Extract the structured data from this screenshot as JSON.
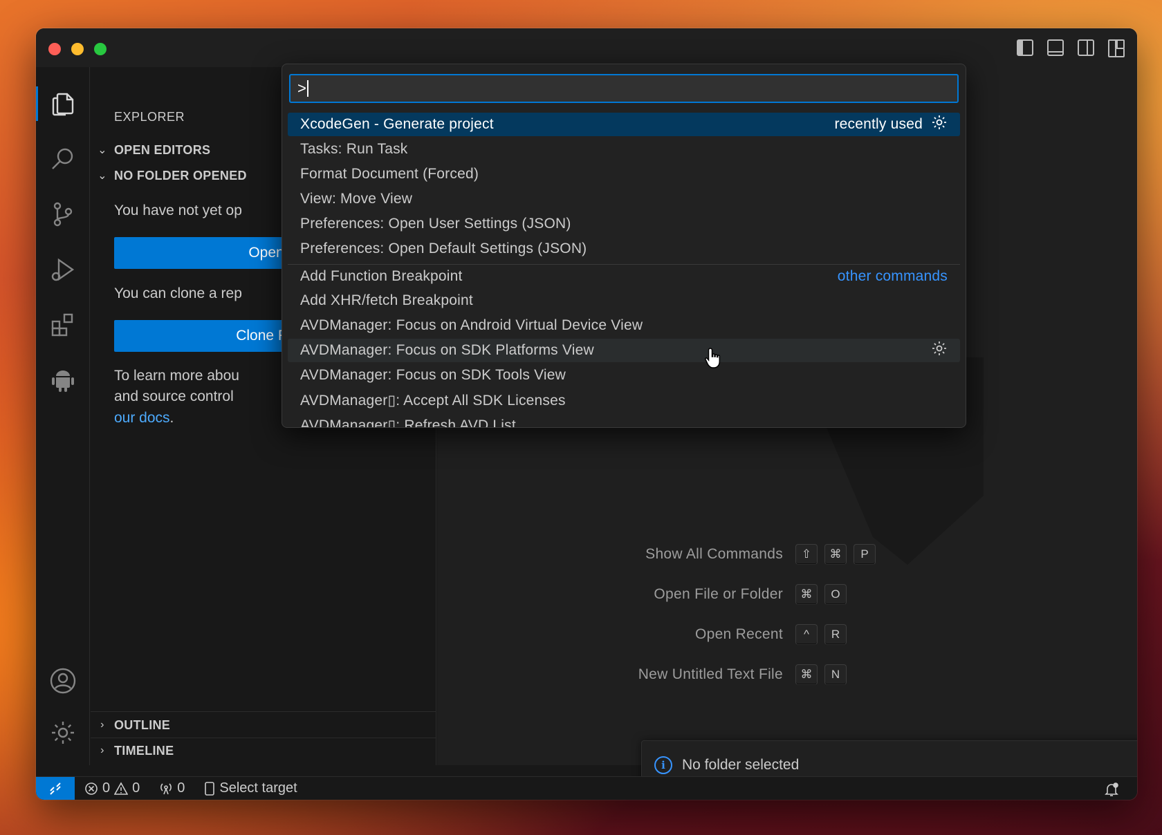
{
  "sidebar": {
    "title": "EXPLORER",
    "open_editors": "OPEN EDITORS",
    "no_folder": "NO FOLDER OPENED",
    "msg1": "You have not yet op",
    "open_btn": "Open",
    "msg2": "You can clone a rep",
    "clone_btn": "Clone Re",
    "learn1": "To learn more abou",
    "learn2": "and source control",
    "docs_link": "our docs",
    "docs_suffix": ".",
    "outline": "OUTLINE",
    "timeline": "TIMELINE"
  },
  "palette": {
    "input_value": ">",
    "items": [
      {
        "label": "XcodeGen - Generate project",
        "hint": "recently used"
      },
      {
        "label": "Tasks: Run Task"
      },
      {
        "label": "Format Document (Forced)"
      },
      {
        "label": "View: Move View"
      },
      {
        "label": "Preferences: Open User Settings (JSON)"
      },
      {
        "label": "Preferences: Open Default Settings (JSON)"
      },
      {
        "label": "Add Function Breakpoint",
        "hint": "other commands"
      },
      {
        "label": "Add XHR/fetch Breakpoint"
      },
      {
        "label": "AVDManager: Focus on Android Virtual Device View"
      },
      {
        "label": "AVDManager: Focus on SDK Platforms View"
      },
      {
        "label": "AVDManager: Focus on SDK Tools View"
      },
      {
        "label": "AVDManager▯: Accept All SDK Licenses"
      },
      {
        "label": "AVDManager▯: Refresh AVD List"
      }
    ]
  },
  "editor": {
    "shortcuts": [
      {
        "label": "Show All Commands",
        "keys": [
          "⇧",
          "⌘",
          "P"
        ]
      },
      {
        "label": "Open File or Folder",
        "keys": [
          "⌘",
          "O"
        ]
      },
      {
        "label": "Open Recent",
        "keys": [
          "^",
          "R"
        ]
      },
      {
        "label": "New Untitled Text File",
        "keys": [
          "⌘",
          "N"
        ]
      }
    ]
  },
  "notification": {
    "text": "No folder selected",
    "icon": "info-icon"
  },
  "statusbar": {
    "errors": "0",
    "warnings": "0",
    "ports": "0",
    "target": "Select target"
  },
  "colors": {
    "accent": "#0078d4",
    "link": "#3794ff",
    "selection": "#04395e"
  }
}
